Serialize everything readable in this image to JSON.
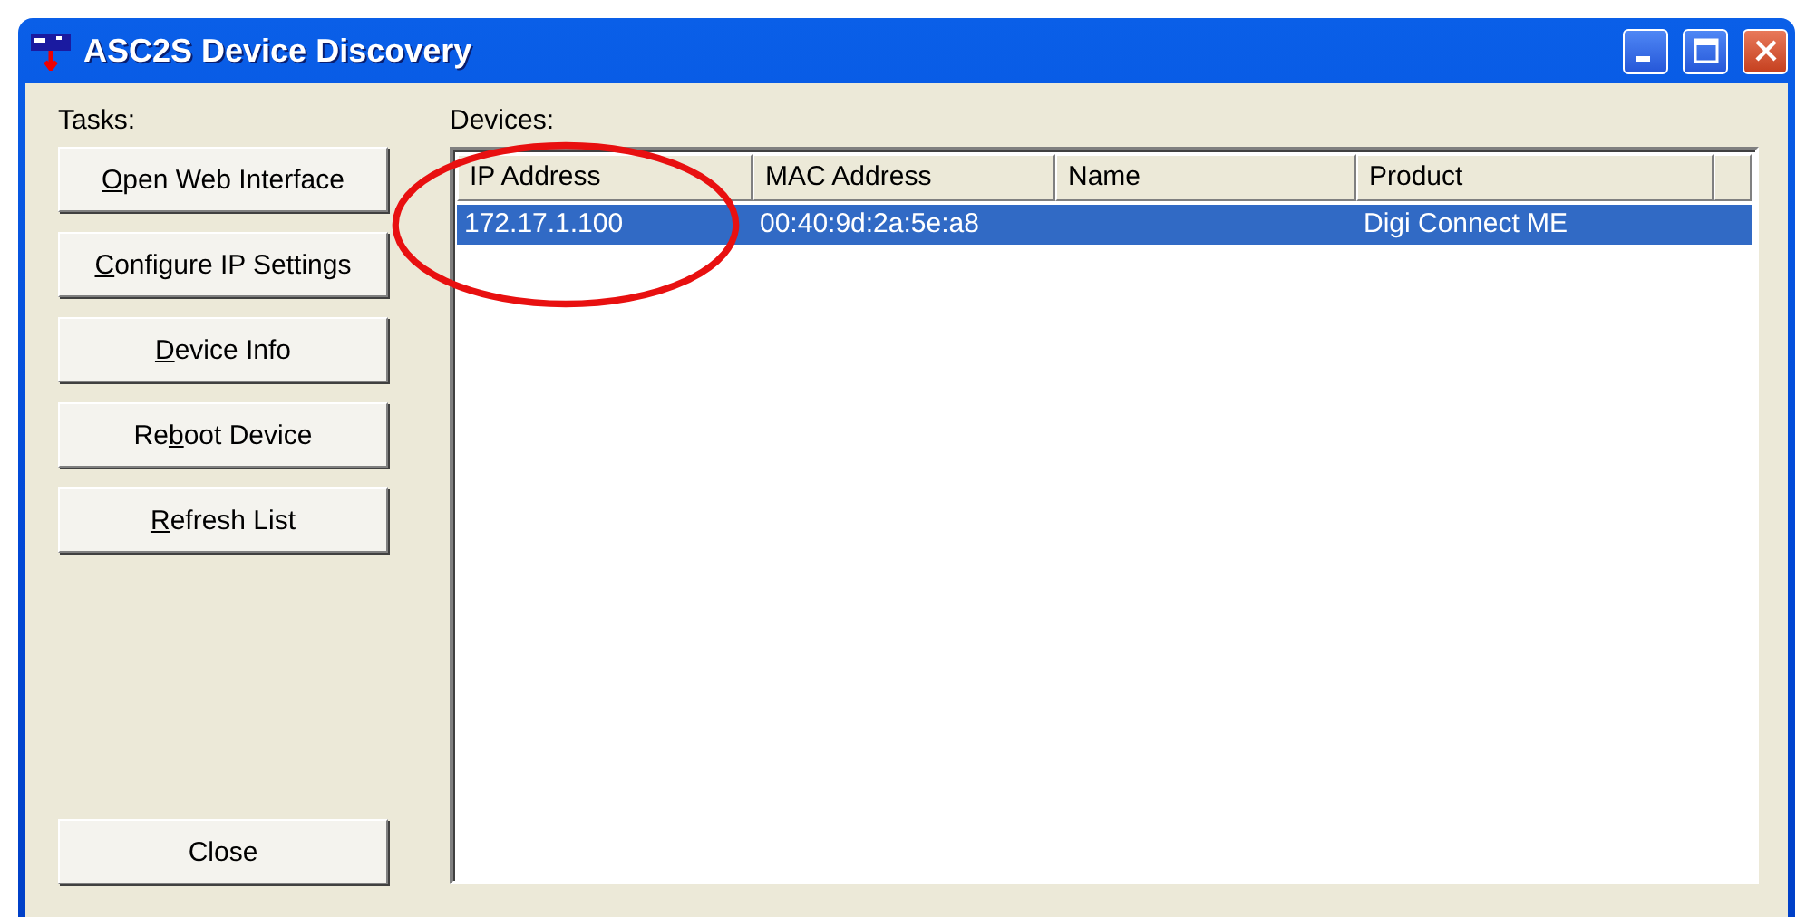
{
  "window": {
    "title": "ASC2S Device Discovery"
  },
  "tasks": {
    "label": "Tasks:",
    "buttons": [
      {
        "key": "O",
        "rest": "pen Web Interface"
      },
      {
        "key": "C",
        "rest": "onfigure IP Settings"
      },
      {
        "key": "D",
        "rest": "evice Info"
      },
      {
        "lead": "Re",
        "key": "b",
        "rest": "oot Device"
      },
      {
        "key": "R",
        "rest": "efresh List"
      }
    ],
    "close": {
      "label": "Close"
    }
  },
  "devices": {
    "label": "Devices:",
    "columns": [
      "IP Address",
      "MAC Address",
      "Name",
      "Product"
    ],
    "rows": [
      {
        "cells": [
          "172.17.1.100",
          "00:40:9d:2a:5e:a8",
          "",
          "Digi Connect ME"
        ],
        "selected": true
      }
    ]
  }
}
